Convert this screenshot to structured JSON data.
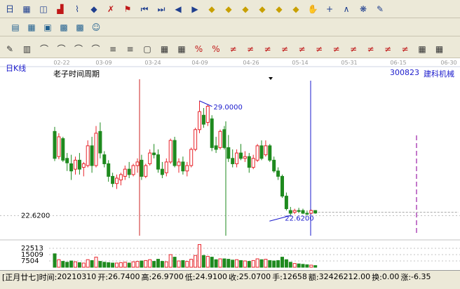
{
  "toolbar1": [
    "日",
    "chart",
    "info",
    "red-chart",
    "trend",
    "cursor",
    "delete",
    "flag",
    "first",
    "next",
    "prev",
    "last",
    "diamond",
    "diamond",
    "diamond",
    "diamond",
    "diamond",
    "diamond",
    "hand",
    "cross",
    "line",
    "gift",
    "pen"
  ],
  "toolbar2": [
    "calendar",
    "calc",
    "window",
    "save",
    "save2",
    "people"
  ],
  "toolbar3": [
    "pen",
    "bars",
    "arc",
    "arc",
    "arc",
    "arc",
    "fan",
    "fan",
    "sel",
    "sq",
    "grid",
    "pct",
    "pct",
    "sym",
    "sym",
    "sym",
    "sym",
    "sym",
    "sym",
    "sym",
    "sym",
    "sym",
    "sym",
    "sym",
    "grid2",
    "grid3"
  ],
  "header": {
    "left_label": "日K线",
    "title": "老子时间周期",
    "code": "300823",
    "name": "建科机械"
  },
  "status": {
    "lunar": "[正月廿七]",
    "date_label": "时间:",
    "date": "20210310",
    "open_label": "开:",
    "open": "26.7400",
    "high_label": "高:",
    "high": "26.9700",
    "low_label": "低:",
    "low": "24.9100",
    "close_label": "收:",
    "close": "25.0700",
    "hand_label": "手:",
    "hand": "12658",
    "amount_label": "额:",
    "amount": "32426212.00",
    "turnover_label": "换:",
    "turnover": "0.00",
    "change_label": "涨:",
    "change": "-6.35"
  },
  "chart_data": {
    "type": "candlestick",
    "title": "老子时间周期",
    "date_ticks": [
      "02-22",
      "03-09",
      "03-24",
      "04-09",
      "04-26",
      "05-14",
      "05-31",
      "06-15",
      "06-30"
    ],
    "price_labels": {
      "high_marker": "29.0000",
      "low_marker": "22.6200",
      "axis_price": "22.6200"
    },
    "volume_ticks": [
      "22513",
      "15009",
      "7504"
    ],
    "ylim": [
      21.5,
      30.2
    ],
    "volume_max": 30000,
    "colors": {
      "up": "#e8242b",
      "down": "#1e8a1e",
      "vline_red": "#cc2020",
      "vline_green": "#1e8a1e",
      "vline_blue": "#1a1acc",
      "vline_purple": "#9b1fa6",
      "label": "#1a1acc"
    },
    "candles": [
      {
        "o": 27.3,
        "h": 27.55,
        "l": 25.65,
        "c": 25.8,
        "v": 16000
      },
      {
        "o": 25.9,
        "h": 27.2,
        "l": 25.75,
        "c": 27.0,
        "v": 9000
      },
      {
        "o": 26.9,
        "h": 27.0,
        "l": 25.6,
        "c": 25.7,
        "v": 7000
      },
      {
        "o": 25.8,
        "h": 26.1,
        "l": 25.1,
        "c": 25.55,
        "v": 6000
      },
      {
        "o": 25.5,
        "h": 26.0,
        "l": 24.6,
        "c": 25.1,
        "v": 7500
      },
      {
        "o": 25.2,
        "h": 25.9,
        "l": 24.9,
        "c": 25.7,
        "v": 6500
      },
      {
        "o": 25.7,
        "h": 26.1,
        "l": 24.9,
        "c": 25.2,
        "v": 5500
      },
      {
        "o": 25.3,
        "h": 25.6,
        "l": 24.8,
        "c": 25.5,
        "v": 5000
      },
      {
        "o": 25.4,
        "h": 26.8,
        "l": 25.3,
        "c": 26.5,
        "v": 9000
      },
      {
        "o": 26.5,
        "h": 27.0,
        "l": 25.0,
        "c": 25.4,
        "v": 8000
      },
      {
        "o": 25.4,
        "h": 27.6,
        "l": 25.3,
        "c": 27.2,
        "v": 12000
      },
      {
        "o": 27.3,
        "h": 27.8,
        "l": 25.8,
        "c": 26.1,
        "v": 7000
      },
      {
        "o": 26.0,
        "h": 26.2,
        "l": 25.3,
        "c": 25.5,
        "v": 6000
      },
      {
        "o": 25.5,
        "h": 25.7,
        "l": 24.5,
        "c": 24.8,
        "v": 5500
      },
      {
        "o": 24.8,
        "h": 25.0,
        "l": 24.2,
        "c": 24.4,
        "v": 5000
      },
      {
        "o": 24.4,
        "h": 24.9,
        "l": 24.1,
        "c": 24.7,
        "v": 5000
      },
      {
        "o": 24.6,
        "h": 25.0,
        "l": 24.3,
        "c": 24.9,
        "v": 5500
      },
      {
        "o": 24.8,
        "h": 25.4,
        "l": 24.6,
        "c": 25.2,
        "v": 6000
      },
      {
        "o": 25.2,
        "h": 25.6,
        "l": 24.7,
        "c": 24.9,
        "v": 5000
      },
      {
        "o": 24.9,
        "h": 25.5,
        "l": 24.8,
        "c": 25.4,
        "v": 6500
      },
      {
        "o": 25.4,
        "h": 25.8,
        "l": 25.0,
        "c": 25.6,
        "v": 7000
      },
      {
        "o": 25.7,
        "h": 26.0,
        "l": 24.6,
        "c": 24.8,
        "v": 7500
      },
      {
        "o": 24.8,
        "h": 25.5,
        "l": 24.7,
        "c": 25.4,
        "v": 8000
      },
      {
        "o": 25.5,
        "h": 26.3,
        "l": 25.4,
        "c": 26.1,
        "v": 9000
      },
      {
        "o": 26.1,
        "h": 26.6,
        "l": 25.8,
        "c": 26.0,
        "v": 7000
      },
      {
        "o": 26.0,
        "h": 26.3,
        "l": 25.0,
        "c": 25.2,
        "v": 9500
      },
      {
        "o": 25.2,
        "h": 25.6,
        "l": 24.7,
        "c": 24.9,
        "v": 7000
      },
      {
        "o": 25.0,
        "h": 25.8,
        "l": 24.8,
        "c": 25.6,
        "v": 6500
      },
      {
        "o": 25.6,
        "h": 26.9,
        "l": 25.5,
        "c": 26.8,
        "v": 15000
      },
      {
        "o": 26.8,
        "h": 27.0,
        "l": 25.3,
        "c": 25.4,
        "v": 12000
      },
      {
        "o": 25.4,
        "h": 25.8,
        "l": 25.0,
        "c": 25.6,
        "v": 7500
      },
      {
        "o": 25.6,
        "h": 25.9,
        "l": 24.9,
        "c": 25.1,
        "v": 8000
      },
      {
        "o": 25.1,
        "h": 25.6,
        "l": 24.8,
        "c": 25.4,
        "v": 7000
      },
      {
        "o": 25.4,
        "h": 26.4,
        "l": 25.3,
        "c": 26.3,
        "v": 9500
      },
      {
        "o": 26.3,
        "h": 27.5,
        "l": 26.2,
        "c": 27.4,
        "v": 14000
      },
      {
        "o": 27.4,
        "h": 29.0,
        "l": 27.2,
        "c": 28.4,
        "v": 27000
      },
      {
        "o": 28.2,
        "h": 28.6,
        "l": 27.5,
        "c": 27.7,
        "v": 14000
      },
      {
        "o": 27.8,
        "h": 28.8,
        "l": 27.6,
        "c": 28.7,
        "v": 13000
      },
      {
        "o": 28.0,
        "h": 28.2,
        "l": 26.2,
        "c": 26.4,
        "v": 12000
      },
      {
        "o": 26.5,
        "h": 27.0,
        "l": 26.1,
        "c": 26.3,
        "v": 9000
      },
      {
        "o": 26.4,
        "h": 27.4,
        "l": 26.3,
        "c": 27.3,
        "v": 10000
      },
      {
        "o": 27.4,
        "h": 27.6,
        "l": 26.3,
        "c": 26.4,
        "v": 10000
      },
      {
        "o": 26.4,
        "h": 27.1,
        "l": 25.6,
        "c": 25.8,
        "v": 9500
      },
      {
        "o": 25.8,
        "h": 26.3,
        "l": 25.3,
        "c": 25.5,
        "v": 8500
      },
      {
        "o": 25.5,
        "h": 26.3,
        "l": 25.3,
        "c": 26.1,
        "v": 9000
      },
      {
        "o": 26.1,
        "h": 26.6,
        "l": 25.7,
        "c": 25.8,
        "v": 8000
      },
      {
        "o": 25.8,
        "h": 26.2,
        "l": 25.6,
        "c": 25.9,
        "v": 7500
      },
      {
        "o": 25.9,
        "h": 26.1,
        "l": 25.0,
        "c": 25.3,
        "v": 7000
      },
      {
        "o": 25.3,
        "h": 26.0,
        "l": 25.2,
        "c": 25.8,
        "v": 8000
      },
      {
        "o": 25.7,
        "h": 26.6,
        "l": 25.6,
        "c": 26.5,
        "v": 10000
      },
      {
        "o": 26.5,
        "h": 26.8,
        "l": 25.7,
        "c": 25.8,
        "v": 9000
      },
      {
        "o": 26.0,
        "h": 26.8,
        "l": 25.9,
        "c": 26.5,
        "v": 9500
      },
      {
        "o": 26.5,
        "h": 26.6,
        "l": 25.6,
        "c": 25.7,
        "v": 8000
      },
      {
        "o": 25.7,
        "h": 25.9,
        "l": 25.0,
        "c": 25.1,
        "v": 7500
      },
      {
        "o": 25.1,
        "h": 25.3,
        "l": 24.6,
        "c": 24.8,
        "v": 8000
      },
      {
        "o": 24.8,
        "h": 24.9,
        "l": 23.6,
        "c": 23.7,
        "v": 12000
      },
      {
        "o": 23.7,
        "h": 23.9,
        "l": 22.9,
        "c": 23.0,
        "v": 9000
      },
      {
        "o": 22.9,
        "h": 23.1,
        "l": 22.62,
        "c": 22.75,
        "v": 6000
      },
      {
        "o": 22.8,
        "h": 23.0,
        "l": 22.7,
        "c": 22.9,
        "v": 4500
      },
      {
        "o": 22.9,
        "h": 23.05,
        "l": 22.75,
        "c": 22.85,
        "v": 4000
      },
      {
        "o": 22.9,
        "h": 23.0,
        "l": 22.7,
        "c": 22.75,
        "v": 3500
      },
      {
        "o": 22.75,
        "h": 22.9,
        "l": 22.64,
        "c": 22.7,
        "v": 3000
      },
      {
        "o": 22.75,
        "h": 22.95,
        "l": 22.7,
        "c": 22.9,
        "v": 2500
      },
      {
        "o": 22.9,
        "h": 22.92,
        "l": 22.72,
        "c": 22.76,
        "v": 2000
      }
    ]
  }
}
